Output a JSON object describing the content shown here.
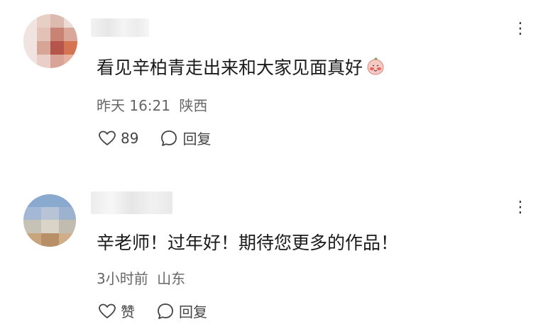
{
  "comments": [
    {
      "text": "看见辛柏青走出来和大家见面真好",
      "emoji": "shy-peach-emoji",
      "time": "昨天 16:21",
      "location": "陕西",
      "like_label": "89",
      "reply_label": "回复",
      "more_label": "⋮"
    },
    {
      "text": "辛老师！过年好！期待您更多的作品！",
      "time": "3小时前",
      "location": "山东",
      "like_label": "赞",
      "reply_label": "回复",
      "more_label": "⋮"
    }
  ],
  "icons": {
    "like": "heart-outline-icon",
    "reply": "speech-bubble-icon",
    "more": "vertical-ellipsis-icon"
  },
  "colors": {
    "text": "#1a1a1a",
    "meta": "#666666",
    "icon": "#444444"
  }
}
